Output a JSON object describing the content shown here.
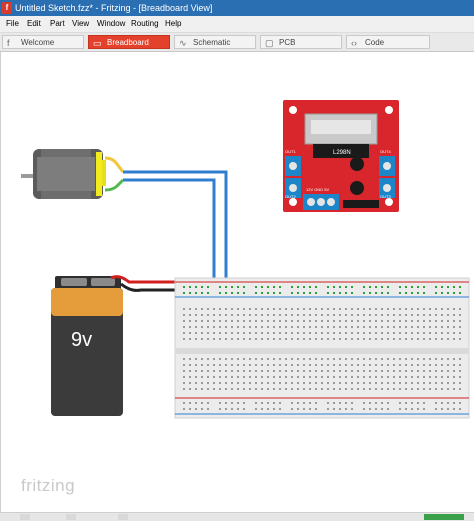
{
  "window": {
    "title": "Untitled Sketch.fzz* - Fritzing - [Breadboard View]",
    "app_icon": "f"
  },
  "menu": {
    "items": [
      "File",
      "Edit",
      "Part",
      "View",
      "Window",
      "Routing",
      "Help"
    ]
  },
  "tabs": [
    {
      "label": "Welcome",
      "icon": "f",
      "active": false
    },
    {
      "label": "Breadboard",
      "icon": "▭",
      "active": true
    },
    {
      "label": "Schematic",
      "icon": "∿",
      "active": false
    },
    {
      "label": "PCB",
      "icon": "▢",
      "active": false
    },
    {
      "label": "Code",
      "icon": "‹›",
      "active": false
    }
  ],
  "canvas": {
    "battery_label": "9v",
    "module_label": "L298N",
    "out1_label": "OUT1",
    "out2_label": "OUT2",
    "out3_label": "OUT3",
    "out4_label": "OUT4",
    "power_label": "12V GND 5V",
    "logo": "fritzing"
  },
  "colors": {
    "titlebar": "#2b6fb3",
    "active_tab": "#e3412b",
    "module_red": "#d8262c",
    "battery_orange": "#e59c3b",
    "wire_blue": "#2f7ed0",
    "wire_red": "#d11f1f",
    "breadboard_green": "#2aa13a"
  }
}
